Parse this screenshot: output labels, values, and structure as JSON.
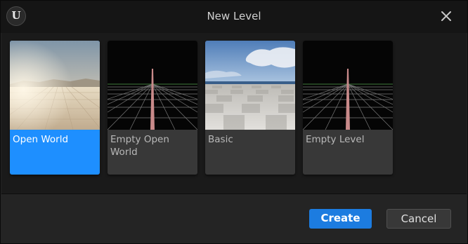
{
  "window": {
    "title": "New Level",
    "logo_glyph": "U"
  },
  "templates": [
    {
      "label": "Open World",
      "selected": true,
      "thumbnail": "desert-landscape"
    },
    {
      "label": "Empty Open World",
      "selected": false,
      "thumbnail": "grid-perspective"
    },
    {
      "label": "Basic",
      "selected": false,
      "thumbnail": "sky-checker-floor"
    },
    {
      "label": "Empty Level",
      "selected": false,
      "thumbnail": "grid-perspective"
    }
  ],
  "buttons": {
    "create": "Create",
    "cancel": "Cancel"
  },
  "colors": {
    "accent": "#1e8fff",
    "create_button": "#1c7ce0"
  },
  "icons": [
    "unreal-logo-icon",
    "close-icon"
  ]
}
